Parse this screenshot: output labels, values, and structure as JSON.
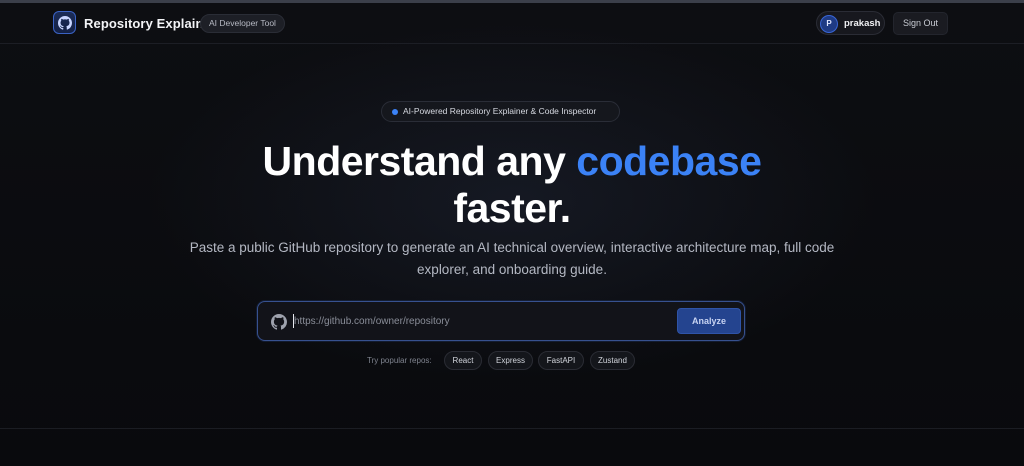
{
  "header": {
    "brand": "Repository Explainer",
    "tag": "AI Developer Tool",
    "user": {
      "initial": "P",
      "name": "prakash"
    },
    "signout_label": "Sign Out"
  },
  "hero": {
    "badge": "AI-Powered Repository Explainer & Code Inspector",
    "headline_part1": "Understand any ",
    "headline_accent": "codebase",
    "headline_part2": "faster.",
    "subtitle_line1": "Paste a public GitHub repository to generate an AI technical overview, interactive architecture map, full code",
    "subtitle_line2": "explorer, and onboarding guide."
  },
  "search": {
    "placeholder": "https://github.com/owner/repository",
    "value": "",
    "button_label": "Analyze"
  },
  "popular": {
    "label": "Try popular repos:",
    "repos": [
      "React",
      "Express",
      "FastAPI",
      "Zustand"
    ]
  },
  "colors": {
    "accent": "#3b82f6",
    "background": "#0b0c10",
    "button": "#24448f"
  },
  "icons": {
    "logo": "github-icon",
    "input": "github-icon",
    "badge": "dot-icon"
  }
}
